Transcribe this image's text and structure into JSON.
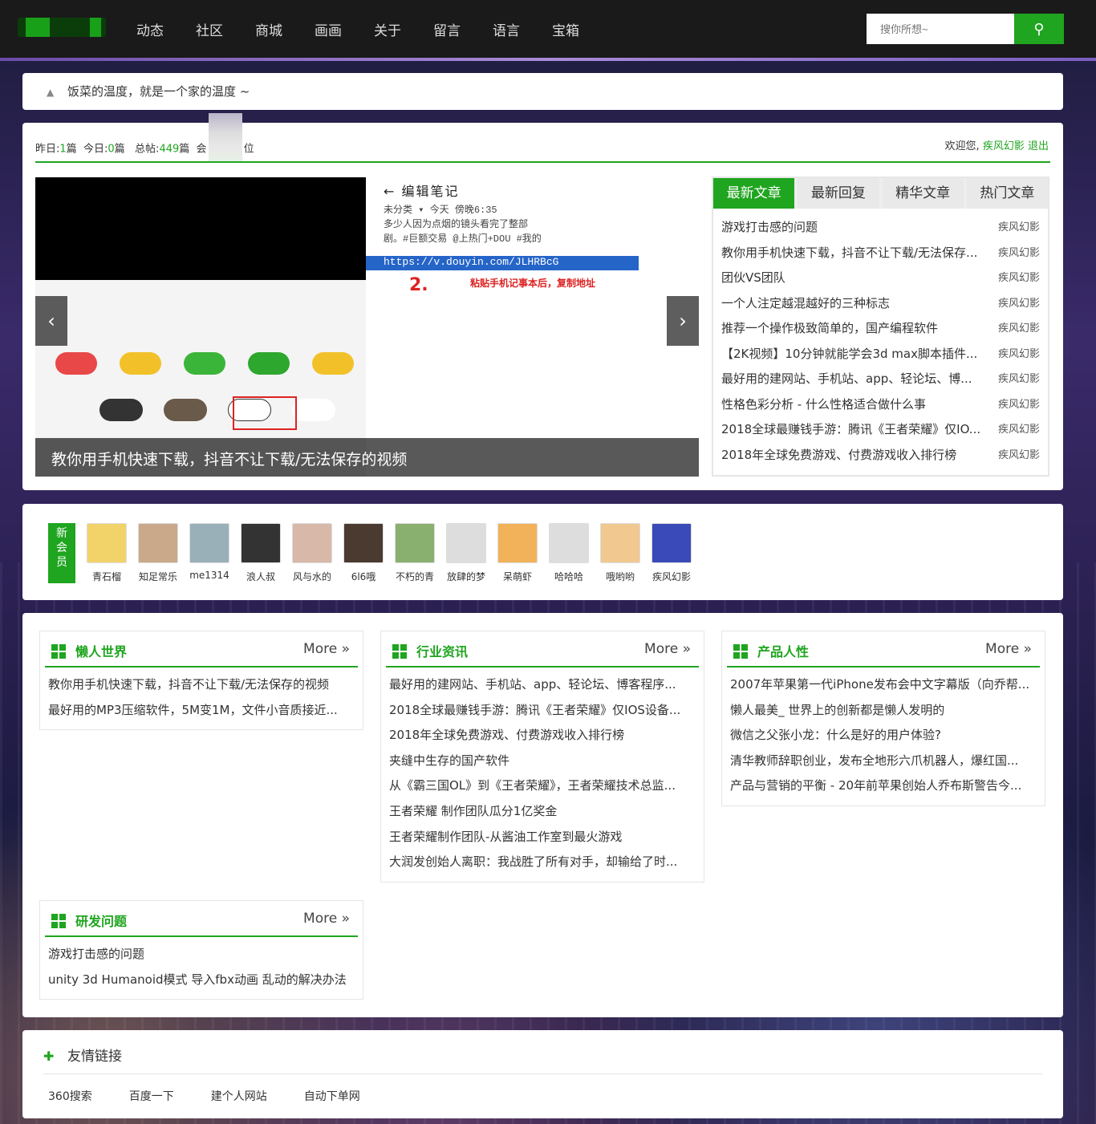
{
  "nav": {
    "items": [
      "动态",
      "社区",
      "商城",
      "画画",
      "关于",
      "留言",
      "语言",
      "宝箱"
    ]
  },
  "search": {
    "placeholder": "搜你所想~",
    "button_icon": "search-icon"
  },
  "notice": {
    "text": "饭菜的温度，就是一个家的温度 ~"
  },
  "stats": {
    "yesterday_label": "昨日:",
    "yesterday": "1",
    "yesterday_unit": "篇",
    "today_label": "今日:",
    "today": "0",
    "today_unit": "篇",
    "total_label": "总帖:",
    "total": "449",
    "total_unit": "篇",
    "member_prefix": "会",
    "member_suffix": "位"
  },
  "welcome": {
    "text": "欢迎您,",
    "user": "疾风幻影",
    "logout": "退出"
  },
  "slider": {
    "caption": "教你用手机快速下载，抖音不让下载/无法保存的视频",
    "right_header": "←  编辑笔记",
    "right_lines": [
      "未分类 ▾          今天 傍晚6:35",
      "多少人因为点烟的镜头看完了整部",
      "剧。#巨额交易 @上热门+DOU #我的"
    ],
    "url": "https://v.douyin.com/JLHRBcG",
    "step_num": "2.",
    "step_text": "粘贴手机记事本后，复制地址"
  },
  "tabs": [
    {
      "label": "最新文章",
      "active": true
    },
    {
      "label": "最新回复",
      "active": false
    },
    {
      "label": "精华文章",
      "active": false
    },
    {
      "label": "热门文章",
      "active": false
    }
  ],
  "latest": [
    {
      "title": "游戏打击感的问题",
      "author": "疾风幻影"
    },
    {
      "title": "教你用手机快速下载，抖音不让下载/无法保存...",
      "author": "疾风幻影"
    },
    {
      "title": "团伙VS团队",
      "author": "疾风幻影"
    },
    {
      "title": "一个人注定越混越好的三种标志",
      "author": "疾风幻影"
    },
    {
      "title": "推荐一个操作极致简单的，国产编程软件",
      "author": "疾风幻影"
    },
    {
      "title": "【2K视频】10分钟就能学会3d max脚本插件...",
      "author": "疾风幻影"
    },
    {
      "title": "最好用的建网站、手机站、app、轻论坛、博...",
      "author": "疾风幻影"
    },
    {
      "title": "性格色彩分析 - 什么性格适合做什么事",
      "author": "疾风幻影"
    },
    {
      "title": "2018全球最赚钱手游：腾讯《王者荣耀》仅IO...",
      "author": "疾风幻影"
    },
    {
      "title": "2018年全球免费游戏、付费游戏收入排行榜",
      "author": "疾风幻影"
    }
  ],
  "members": {
    "tag": [
      "新",
      "会",
      "员"
    ],
    "list": [
      {
        "name": "青石榴",
        "color": "#f2d36a"
      },
      {
        "name": "知足常乐",
        "color": "#c9a98a"
      },
      {
        "name": "me1314",
        "color": "#9ab0b8"
      },
      {
        "name": "浪人叔",
        "color": "#333333"
      },
      {
        "name": "风与水的",
        "color": "#d8b8a8"
      },
      {
        "name": "6l6哦",
        "color": "#4a3a30"
      },
      {
        "name": "不朽的青",
        "color": "#8ab070"
      },
      {
        "name": "放肆的梦",
        "color": "#dddddd"
      },
      {
        "name": "呆萌虾",
        "color": "#f2b25a"
      },
      {
        "name": "哈哈哈",
        "color": "#dddddd"
      },
      {
        "name": "哦哟哟",
        "color": "#f0c890"
      },
      {
        "name": "疾风幻影",
        "color": "#3a4ab8"
      }
    ]
  },
  "sections": [
    {
      "title": "懒人世界",
      "more": "More »",
      "items": [
        "教你用手机快速下载，抖音不让下载/无法保存的视频",
        "最好用的MP3压缩软件，5M变1M，文件小音质接近..."
      ]
    },
    {
      "title": "行业资讯",
      "more": "More »",
      "items": [
        "最好用的建网站、手机站、app、轻论坛、博客程序...",
        "2018全球最赚钱手游：腾讯《王者荣耀》仅IOS设备...",
        "2018年全球免费游戏、付费游戏收入排行榜",
        "夹缝中生存的国产软件",
        "从《霸三国OL》到《王者荣耀》，王者荣耀技术总监...",
        "王者荣耀 制作团队瓜分1亿奖金",
        "王者荣耀制作团队-从酱油工作室到最火游戏",
        "大润发创始人离职：我战胜了所有对手，却输给了时..."
      ]
    },
    {
      "title": "产品人性",
      "more": "More »",
      "items": [
        "2007年苹果第一代iPhone发布会中文字幕版（向乔帮...",
        "懒人最美_ 世界上的创新都是懒人发明的",
        "微信之父张小龙：什么是好的用户体验?",
        "清华教师辞职创业，发布全地形六爪机器人，爆红国...",
        "产品与营销的平衡 - 20年前苹果创始人乔布斯警告今..."
      ]
    },
    {
      "title": "研发问题",
      "more": "More »",
      "items": [
        "游戏打击感的问题",
        "unity 3d Humanoid模式 导入fbx动画 乱动的解决办法"
      ]
    }
  ],
  "links": {
    "title": "友情链接",
    "items": [
      "360搜索",
      "百度一下",
      "建个人网站",
      "自动下单网"
    ]
  },
  "colors": {
    "accent": "#1fa51f",
    "topbar": "#1a1a1a"
  }
}
